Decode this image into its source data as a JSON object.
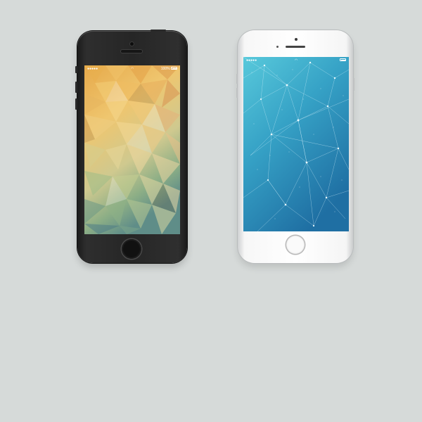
{
  "scene": {
    "background_color": "#d6dad9"
  },
  "phones": [
    {
      "model": "iphone-5s",
      "body_color": "#262626",
      "wallpaper": "warm-low-poly-triangles",
      "status_bar": {
        "signal": "●●●●● ",
        "wifi_icon": "wifi-icon",
        "battery_label": "100%",
        "battery_icon": "battery-icon"
      }
    },
    {
      "model": "iphone-6",
      "body_color": "#f2f2f2",
      "wallpaper": "blue-constellation-network",
      "status_bar": {
        "signal": "●●●●● ",
        "wifi_icon": "wifi-icon",
        "battery_label": "",
        "battery_icon": "battery-icon"
      }
    }
  ]
}
